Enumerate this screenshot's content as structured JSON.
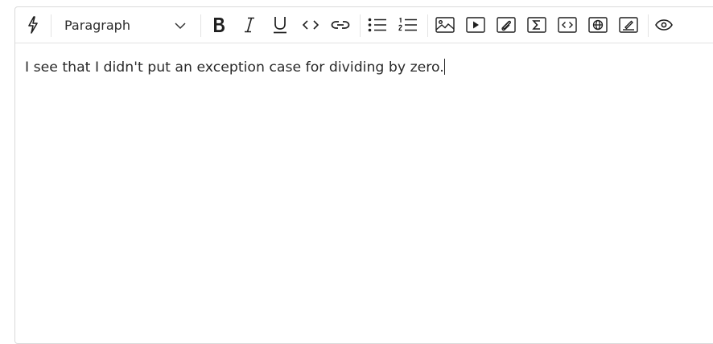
{
  "toolbar": {
    "format_select": {
      "selected": "Paragraph"
    },
    "buttons": [
      {
        "name": "magic",
        "icon": "lightning-icon"
      },
      {
        "name": "bold",
        "icon": "bold-icon"
      },
      {
        "name": "italic",
        "icon": "italic-icon"
      },
      {
        "name": "underline",
        "icon": "underline-icon"
      },
      {
        "name": "code",
        "icon": "code-icon"
      },
      {
        "name": "link",
        "icon": "link-icon"
      },
      {
        "name": "bullet-list",
        "icon": "bullet-list-icon"
      },
      {
        "name": "numbered-list",
        "icon": "numbered-list-icon"
      },
      {
        "name": "image",
        "icon": "image-icon"
      },
      {
        "name": "video",
        "icon": "play-icon"
      },
      {
        "name": "attachment",
        "icon": "paperclip-icon"
      },
      {
        "name": "math",
        "icon": "sigma-icon"
      },
      {
        "name": "code-block",
        "icon": "code-block-icon"
      },
      {
        "name": "embed",
        "icon": "globe-icon"
      },
      {
        "name": "drawing",
        "icon": "pen-icon"
      },
      {
        "name": "preview",
        "icon": "eye-icon"
      }
    ]
  },
  "content": {
    "text": "I see that I didn't put an exception case for dividing by zero."
  },
  "colors": {
    "border": "#d9d9d9",
    "icon": "#1f1f1f",
    "text": "#2a2a2a"
  }
}
